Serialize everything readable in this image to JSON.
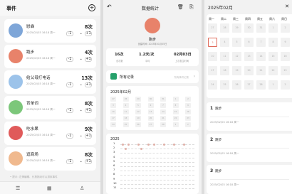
{
  "list_screen": {
    "title": "事件",
    "events": [
      {
        "name": "慰霖",
        "time": "2025/02/03 16:18 周一",
        "count": "8次",
        "avatar_color": "#7ea6d8"
      },
      {
        "name": "跑步",
        "time": "2025/02/03 16:18 周一",
        "count": "4次",
        "avatar_color": "#e8826a"
      },
      {
        "name": "给父母打电话",
        "time": "2025/02/03 16:18 周一",
        "count": "13次",
        "avatar_color": "#9cc3ea"
      },
      {
        "name": "背单词",
        "time": "2025/02/03 16:18 周一",
        "count": "8次",
        "avatar_color": "#7cc77a"
      },
      {
        "name": "吃水果",
        "time": "2025/02/03 16:18 周一",
        "count": "9次",
        "avatar_color": "#e05a5a"
      },
      {
        "name": "逛商场",
        "time": "2025/02/03 16:18 周一",
        "count": "8次",
        "avatar_color": "#f0b98e"
      }
    ],
    "minus_label": "-1",
    "plus_label": "+1",
    "dot_label": "•",
    "tip": "• 提示: 左滑编辑、长按拖动可以排序事件",
    "tabs": [
      "☰",
      "▦",
      "♙"
    ]
  },
  "detail_screen": {
    "title": "数据统计",
    "event_name": "跑步",
    "created": "创建时间: 2025年01月05日",
    "avatar_color": "#e8826a",
    "stats": [
      {
        "value": "16次",
        "label": "总次数"
      },
      {
        "value": "1.2天/次",
        "label": "平均"
      },
      {
        "value": "02月03日",
        "label": "上次发生时间"
      }
    ],
    "all_records_label": "所有记录",
    "all_records_hint": "所有事件记录",
    "month_title": "2025年02月",
    "year_title": "2025",
    "year_rows": [
      "1",
      "2",
      "3",
      "4",
      "5",
      "6",
      "7",
      "8",
      "9",
      "10",
      "11"
    ],
    "tabs": [
      "☰",
      "▦",
      "♙"
    ]
  },
  "calendar_screen": {
    "title": "2025年02月",
    "weekdays": [
      "周一",
      "周二",
      "周三",
      "周四",
      "周五",
      "周六",
      "周日"
    ],
    "days": [
      "27",
      "28",
      "29",
      "30",
      "31",
      "1",
      "2",
      "3",
      "4",
      "5",
      "6",
      "7",
      "8",
      "9",
      "10",
      "11",
      "12",
      "13",
      "14",
      "15",
      "16",
      "17",
      "18",
      "19",
      "20",
      "21",
      "22",
      "23",
      "24",
      "25",
      "26",
      "27",
      "28",
      "1",
      "2"
    ],
    "highlight_index": 7,
    "records": [
      {
        "num": "1",
        "name": "跑步",
        "time": "2025/02/03 16:18 周一"
      },
      {
        "num": "2",
        "name": "跑步",
        "time": "2025/02/03 16:18 周一"
      },
      {
        "num": "3",
        "name": "跑步",
        "time": "2025/02/03 16:18 周一"
      }
    ],
    "tabs": [
      "☰",
      "▦",
      "♙"
    ]
  },
  "colors": {
    "accent_green": "#25a06a",
    "highlight_red": "#e06a5a"
  }
}
